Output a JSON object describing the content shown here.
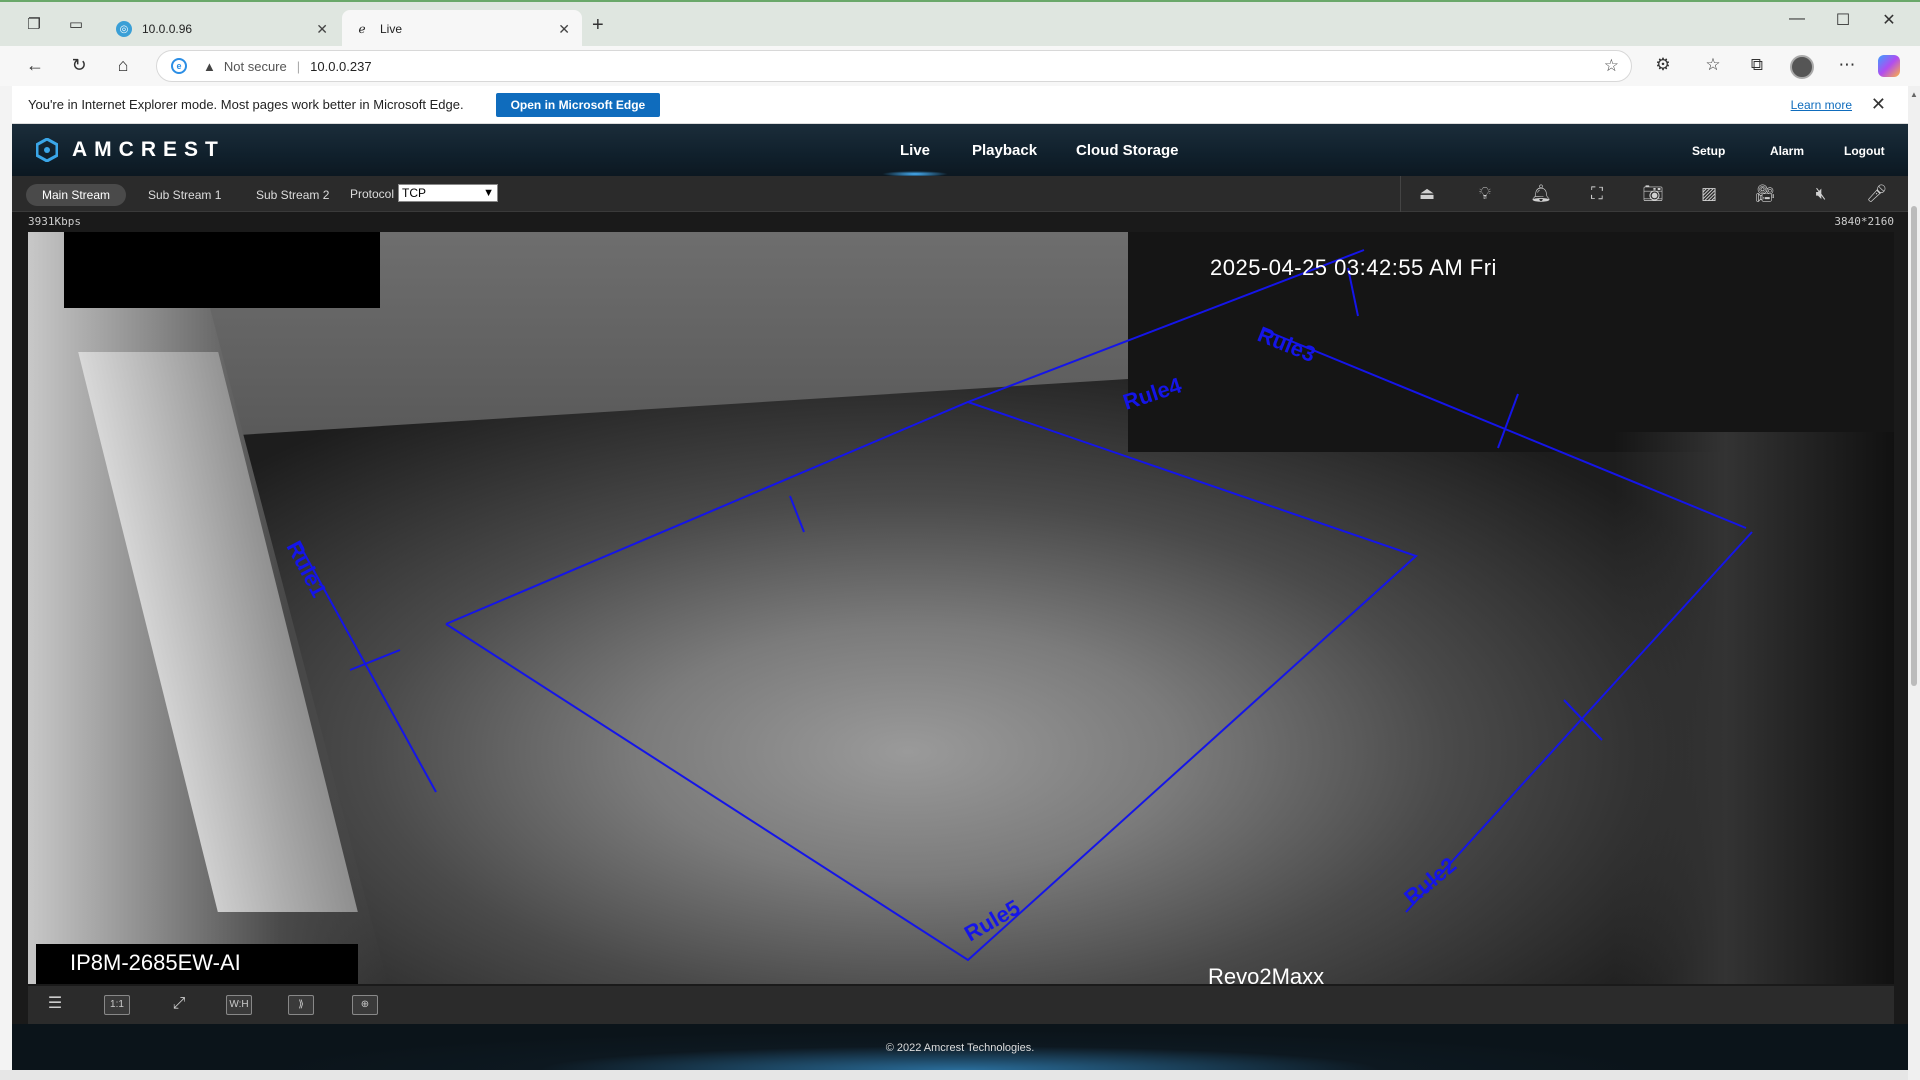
{
  "browser": {
    "tabs": [
      {
        "title": "10.0.0.96",
        "favicon": "amcrest-favicon-icon"
      },
      {
        "title": "Live",
        "favicon": "ie-favicon-icon"
      }
    ],
    "address": {
      "security_label": "Not secure",
      "url": "10.0.0.237"
    },
    "ie_mode_bar": {
      "message": "You're in Internet Explorer mode. Most pages work better in Microsoft Edge.",
      "open_button": "Open in Microsoft Edge",
      "learn_more": "Learn more"
    }
  },
  "app": {
    "logo": "AMCREST",
    "nav": {
      "live": "Live",
      "playback": "Playback",
      "cloud": "Cloud Storage"
    },
    "top_links": {
      "setup": "Setup",
      "alarm": "Alarm",
      "logout": "Logout"
    },
    "streams": {
      "main": "Main Stream",
      "sub1": "Sub Stream 1",
      "sub2": "Sub Stream 2"
    },
    "protocol": {
      "label": "Protocol",
      "value": "TCP"
    },
    "bitrate": "3931Kbps",
    "resolution": "3840*2160",
    "video": {
      "timestamp": "2025-04-25 03:42:55 AM Fri",
      "camera_model": "IP8M-2685EW-AI",
      "channel_name": "Revo2Maxx",
      "rules": [
        "Rule1",
        "Rule2",
        "Rule3",
        "Rule4",
        "Rule5"
      ]
    },
    "bottom_tools": {
      "ratio": "1:1",
      "fit": "W:H"
    },
    "footer": "© 2022 Amcrest Technologies.",
    "colors": {
      "rule_line": "#1010e0",
      "header_bg": "#10202c",
      "accent": "#4ab6ff"
    }
  }
}
